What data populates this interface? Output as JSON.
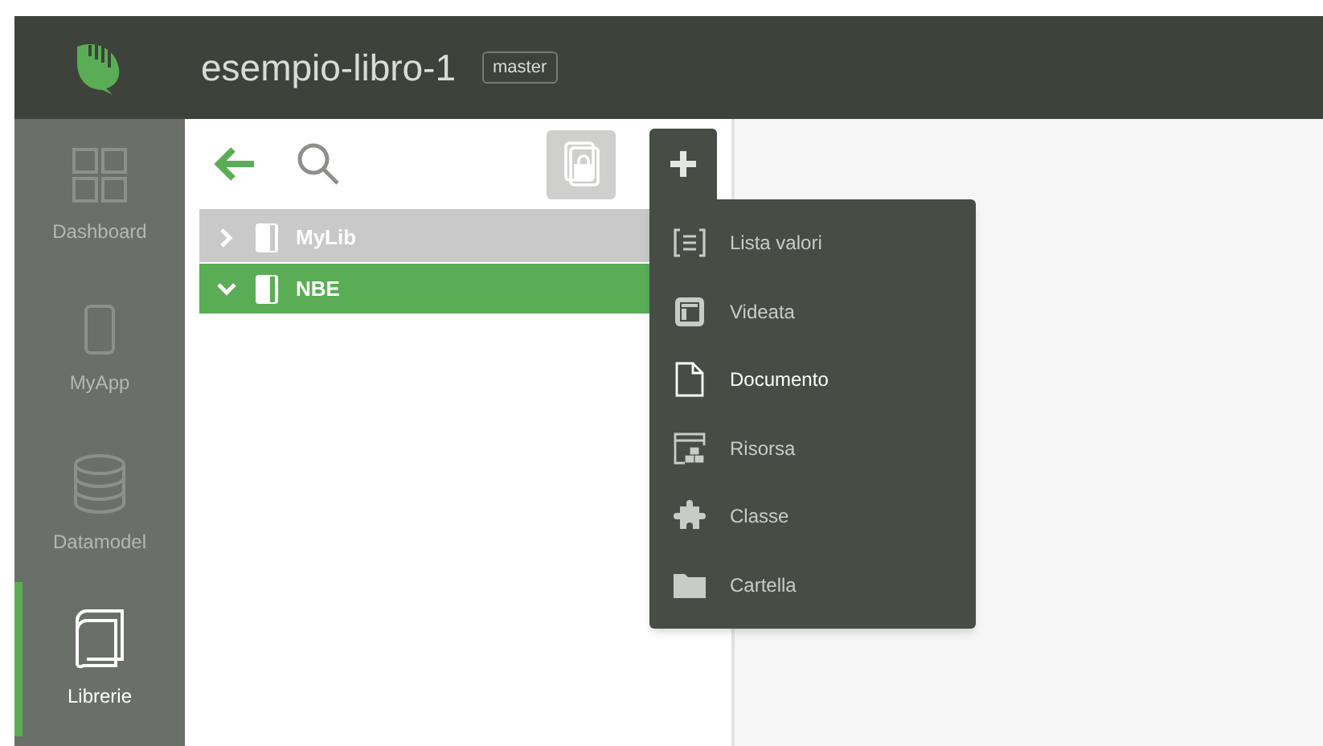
{
  "header": {
    "title": "esempio-libro-1",
    "branch": "master"
  },
  "sidebar": {
    "items": [
      {
        "label": "Dashboard",
        "kind": "grid",
        "selected": false
      },
      {
        "label": "MyApp",
        "kind": "phone",
        "selected": false
      },
      {
        "label": "Datamodel",
        "kind": "database",
        "selected": false
      },
      {
        "label": "Librerie",
        "kind": "book",
        "selected": true
      }
    ]
  },
  "tree": {
    "items": [
      {
        "label": "MyLib",
        "expanded": false,
        "selected": false
      },
      {
        "label": "NBE",
        "expanded": true,
        "selected": true
      }
    ]
  },
  "add_menu": {
    "open": true,
    "items": [
      {
        "label": "Lista valori",
        "kind": "list",
        "selected": false
      },
      {
        "label": "Videata",
        "kind": "form",
        "selected": false
      },
      {
        "label": "Documento",
        "kind": "document",
        "selected": true
      },
      {
        "label": "Risorsa",
        "kind": "resource",
        "selected": false
      },
      {
        "label": "Classe",
        "kind": "puzzle",
        "selected": false
      },
      {
        "label": "Cartella",
        "kind": "folder",
        "selected": false
      }
    ]
  }
}
